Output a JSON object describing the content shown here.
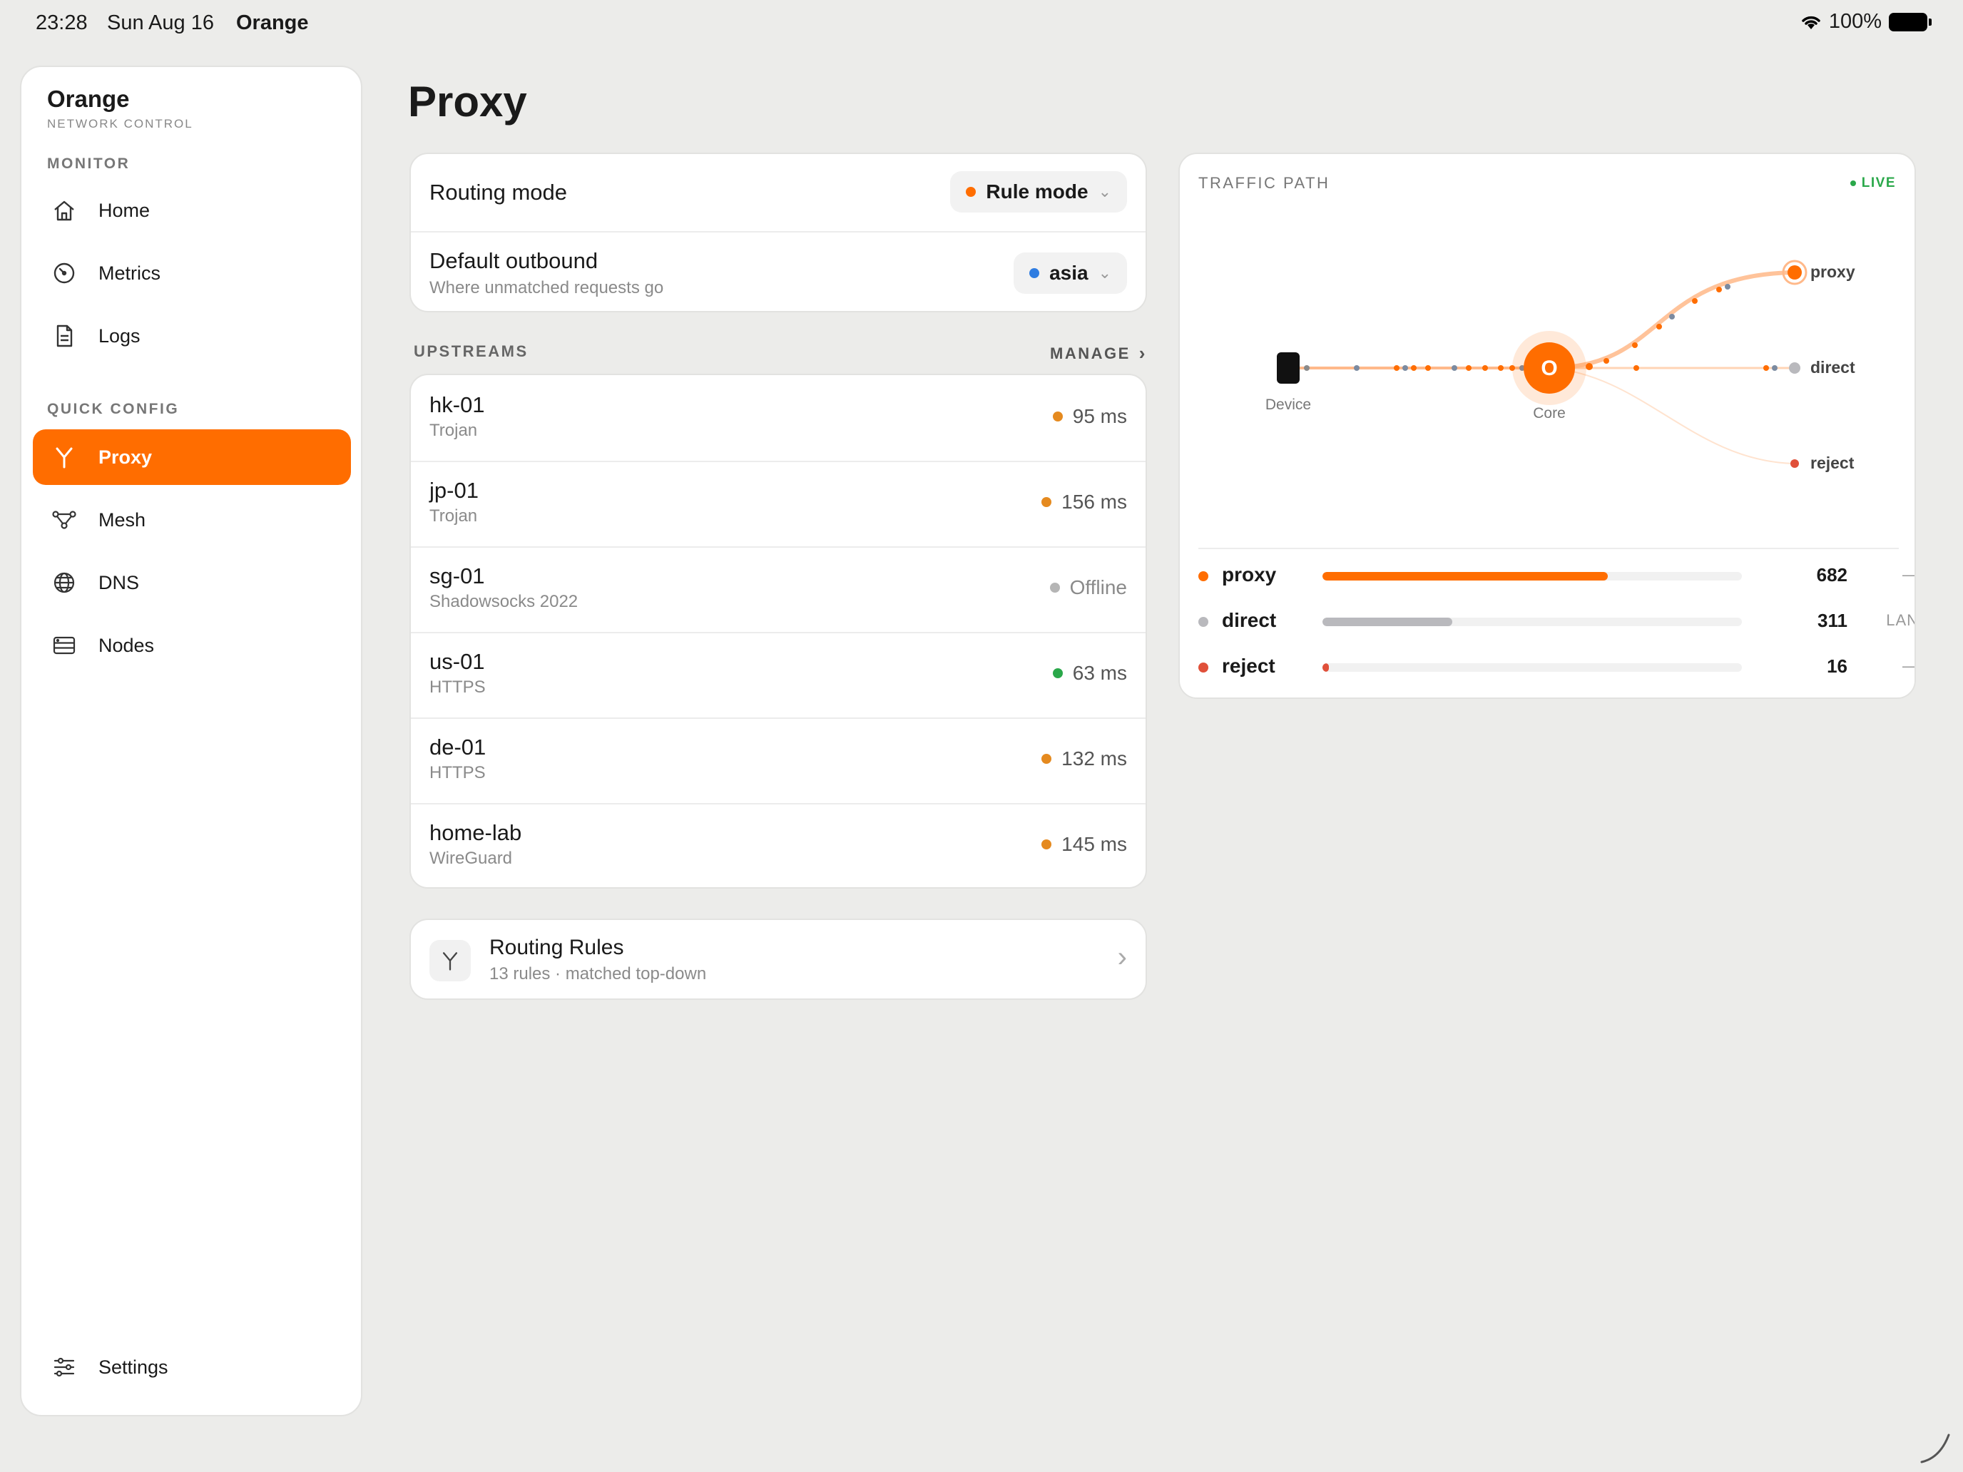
{
  "status_bar": {
    "time": "23:28",
    "date": "Sun Aug 16",
    "carrier": "Orange",
    "battery": "100%"
  },
  "sidebar": {
    "brand": "Orange",
    "brand_sub": "NETWORK CONTROL",
    "monitor_label": "MONITOR",
    "monitor_items": [
      {
        "label": "Home",
        "icon": "home-icon"
      },
      {
        "label": "Metrics",
        "icon": "gauge-icon"
      },
      {
        "label": "Logs",
        "icon": "document-icon"
      }
    ],
    "quick_config_label": "QUICK CONFIG",
    "config_items": [
      {
        "label": "Proxy",
        "icon": "fork-icon",
        "active": true
      },
      {
        "label": "Mesh",
        "icon": "mesh-icon"
      },
      {
        "label": "DNS",
        "icon": "globe-icon"
      },
      {
        "label": "Nodes",
        "icon": "server-icon"
      }
    ],
    "settings_label": "Settings"
  },
  "page": {
    "title": "Proxy"
  },
  "routing": {
    "mode_label": "Routing mode",
    "mode_value": "Rule mode",
    "mode_color": "#ff6d00",
    "outbound_label": "Default outbound",
    "outbound_sub": "Where unmatched requests go",
    "outbound_value": "asia",
    "outbound_color": "#2f7de1"
  },
  "upstreams": {
    "header": "UPSTREAMS",
    "manage": "MANAGE",
    "items": [
      {
        "name": "hk-01",
        "protocol": "Trojan",
        "latency": "95 ms",
        "color": "#e58a1f"
      },
      {
        "name": "jp-01",
        "protocol": "Trojan",
        "latency": "156 ms",
        "color": "#e58a1f"
      },
      {
        "name": "sg-01",
        "protocol": "Shadowsocks 2022",
        "latency": "Offline",
        "color": "#b5b5b5"
      },
      {
        "name": "us-01",
        "protocol": "HTTPS",
        "latency": "63 ms",
        "color": "#2aa84a"
      },
      {
        "name": "de-01",
        "protocol": "HTTPS",
        "latency": "132 ms",
        "color": "#e58a1f"
      },
      {
        "name": "home-lab",
        "protocol": "WireGuard",
        "latency": "145 ms",
        "color": "#e58a1f"
      }
    ]
  },
  "rules": {
    "title": "Routing Rules",
    "subtitle": "13 rules · matched top-down"
  },
  "traffic": {
    "label": "TRAFFIC PATH",
    "live": "LIVE",
    "device_label": "Device",
    "core_label": "Core",
    "core_letter": "O",
    "targets": [
      "proxy",
      "direct",
      "reject"
    ],
    "legend": [
      {
        "name": "proxy",
        "count": "682",
        "note": "—",
        "fraction": 0.68,
        "color": "#ff6d00"
      },
      {
        "name": "direct",
        "count": "311",
        "note": "LAN",
        "fraction": 0.31,
        "color": "#b9b9bd"
      },
      {
        "name": "reject",
        "count": "16",
        "note": "—",
        "fraction": 0.016,
        "color": "#e0503a"
      }
    ]
  }
}
